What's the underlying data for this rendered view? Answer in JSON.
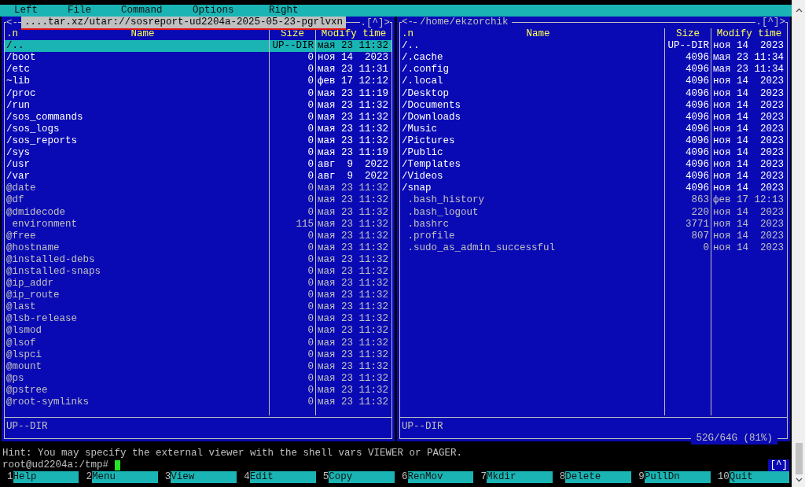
{
  "menu": [
    {
      "label": "Left"
    },
    {
      "label": "File"
    },
    {
      "label": "Command"
    },
    {
      "label": "Options"
    },
    {
      "label": "Right"
    }
  ],
  "panels": [
    {
      "corner_left": "<-",
      "title": "....tar.xz/utar://sosreport-ud2204a-2025-05-23-pgrlvxn",
      "corner_right": ".[^]>",
      "active": true,
      "columns": [
        ".n",
        "Name",
        "Size",
        "Modify time"
      ],
      "status": "UP--DIR",
      "rows": [
        {
          "name": "/..",
          "kind": "dir",
          "size": "UP--DIR",
          "time": "мая 23 11:32",
          "selected": true
        },
        {
          "name": "/boot",
          "kind": "dir",
          "size": "0",
          "time": "ноя 14  2023",
          "selected": false
        },
        {
          "name": "/etc",
          "kind": "dir",
          "size": "0",
          "time": "мая 23 11:31",
          "selected": false
        },
        {
          "name": "~lib",
          "kind": "dir",
          "size": "0",
          "time": "фев 17 12:12",
          "selected": false
        },
        {
          "name": "/proc",
          "kind": "dir",
          "size": "0",
          "time": "мая 23 11:19",
          "selected": false
        },
        {
          "name": "/run",
          "kind": "dir",
          "size": "0",
          "time": "мая 23 11:32",
          "selected": false
        },
        {
          "name": "/sos_commands",
          "kind": "dir",
          "size": "0",
          "time": "мая 23 11:32",
          "selected": false
        },
        {
          "name": "/sos_logs",
          "kind": "dir",
          "size": "0",
          "time": "мая 23 11:32",
          "selected": false
        },
        {
          "name": "/sos_reports",
          "kind": "dir",
          "size": "0",
          "time": "мая 23 11:32",
          "selected": false
        },
        {
          "name": "/sys",
          "kind": "dir",
          "size": "0",
          "time": "мая 23 11:19",
          "selected": false
        },
        {
          "name": "/usr",
          "kind": "dir",
          "size": "0",
          "time": "авг  9  2022",
          "selected": false
        },
        {
          "name": "/var",
          "kind": "dir",
          "size": "0",
          "time": "авг  9  2022",
          "selected": false
        },
        {
          "name": "@date",
          "kind": "link",
          "size": "0",
          "time": "мая 23 11:32",
          "selected": false
        },
        {
          "name": "@df",
          "kind": "link",
          "size": "0",
          "time": "мая 23 11:32",
          "selected": false
        },
        {
          "name": "@dmidecode",
          "kind": "link",
          "size": "0",
          "time": "мая 23 11:32",
          "selected": false
        },
        {
          "name": "environment",
          "kind": "file",
          "size": "115",
          "time": "мая 23 11:32",
          "selected": false
        },
        {
          "name": "@free",
          "kind": "link",
          "size": "0",
          "time": "мая 23 11:32",
          "selected": false
        },
        {
          "name": "@hostname",
          "kind": "link",
          "size": "0",
          "time": "мая 23 11:32",
          "selected": false
        },
        {
          "name": "@installed-debs",
          "kind": "link",
          "size": "0",
          "time": "мая 23 11:32",
          "selected": false
        },
        {
          "name": "@installed-snaps",
          "kind": "link",
          "size": "0",
          "time": "мая 23 11:32",
          "selected": false
        },
        {
          "name": "@ip_addr",
          "kind": "link",
          "size": "0",
          "time": "мая 23 11:32",
          "selected": false
        },
        {
          "name": "@ip_route",
          "kind": "link",
          "size": "0",
          "time": "мая 23 11:32",
          "selected": false
        },
        {
          "name": "@last",
          "kind": "link",
          "size": "0",
          "time": "мая 23 11:32",
          "selected": false
        },
        {
          "name": "@lsb-release",
          "kind": "link",
          "size": "0",
          "time": "мая 23 11:32",
          "selected": false
        },
        {
          "name": "@lsmod",
          "kind": "link",
          "size": "0",
          "time": "мая 23 11:32",
          "selected": false
        },
        {
          "name": "@lsof",
          "kind": "link",
          "size": "0",
          "time": "мая 23 11:32",
          "selected": false
        },
        {
          "name": "@lspci",
          "kind": "link",
          "size": "0",
          "time": "мая 23 11:32",
          "selected": false
        },
        {
          "name": "@mount",
          "kind": "link",
          "size": "0",
          "time": "мая 23 11:32",
          "selected": false
        },
        {
          "name": "@ps",
          "kind": "link",
          "size": "0",
          "time": "мая 23 11:32",
          "selected": false
        },
        {
          "name": "@pstree",
          "kind": "link",
          "size": "0",
          "time": "мая 23 11:32",
          "selected": false
        },
        {
          "name": "@root-symlinks",
          "kind": "link",
          "size": "0",
          "time": "мая 23 11:32",
          "selected": false
        }
      ]
    },
    {
      "corner_left": "<-",
      "title": "/home/ekzorchik",
      "corner_right": ".[^]>",
      "active": false,
      "columns": [
        ".n",
        "Name",
        "Size",
        "Modify time"
      ],
      "status": "UP--DIR",
      "disk": "52G/64G (81%)",
      "rows": [
        {
          "name": "/..",
          "kind": "dir",
          "size": "UP--DIR",
          "time": "ноя 14  2023",
          "selected": false
        },
        {
          "name": "/.cache",
          "kind": "dir",
          "size": "4096",
          "time": "мая 23 11:34",
          "selected": false
        },
        {
          "name": "/.config",
          "kind": "dir",
          "size": "4096",
          "time": "мая 23 11:34",
          "selected": false
        },
        {
          "name": "/.local",
          "kind": "dir",
          "size": "4096",
          "time": "ноя 14  2023",
          "selected": false
        },
        {
          "name": "/Desktop",
          "kind": "dir",
          "size": "4096",
          "time": "ноя 14  2023",
          "selected": false
        },
        {
          "name": "/Documents",
          "kind": "dir",
          "size": "4096",
          "time": "ноя 14  2023",
          "selected": false
        },
        {
          "name": "/Downloads",
          "kind": "dir",
          "size": "4096",
          "time": "ноя 14  2023",
          "selected": false
        },
        {
          "name": "/Music",
          "kind": "dir",
          "size": "4096",
          "time": "ноя 14  2023",
          "selected": false
        },
        {
          "name": "/Pictures",
          "kind": "dir",
          "size": "4096",
          "time": "ноя 14  2023",
          "selected": false
        },
        {
          "name": "/Public",
          "kind": "dir",
          "size": "4096",
          "time": "ноя 14  2023",
          "selected": false
        },
        {
          "name": "/Templates",
          "kind": "dir",
          "size": "4096",
          "time": "ноя 14  2023",
          "selected": false
        },
        {
          "name": "/Videos",
          "kind": "dir",
          "size": "4096",
          "time": "ноя 14  2023",
          "selected": false
        },
        {
          "name": "/snap",
          "kind": "dir",
          "size": "4096",
          "time": "ноя 14  2023",
          "selected": false
        },
        {
          "name": ".bash_history",
          "kind": "file",
          "size": "863",
          "time": "фев 17 12:13",
          "selected": false
        },
        {
          "name": ".bash_logout",
          "kind": "file",
          "size": "220",
          "time": "ноя 14  2023",
          "selected": false
        },
        {
          "name": ".bashrc",
          "kind": "file",
          "size": "3771",
          "time": "ноя 14  2023",
          "selected": false
        },
        {
          "name": ".profile",
          "kind": "file",
          "size": "807",
          "time": "ноя 14  2023",
          "selected": false
        },
        {
          "name": ".sudo_as_admin_successful",
          "kind": "file",
          "size": "0",
          "time": "ноя 14  2023",
          "selected": false
        }
      ]
    }
  ],
  "hint": "Hint: You may specify the external viewer with the shell vars VIEWER or PAGER.",
  "prompt": "root@ud2204a:/tmp#",
  "prompt_badge": "[^]",
  "fkeys": [
    {
      "num": "1",
      "label": "Help"
    },
    {
      "num": "2",
      "label": "Menu"
    },
    {
      "num": "3",
      "label": "View"
    },
    {
      "num": "4",
      "label": "Edit"
    },
    {
      "num": "5",
      "label": "Copy"
    },
    {
      "num": "6",
      "label": "RenMov"
    },
    {
      "num": "7",
      "label": "Mkdir"
    },
    {
      "num": "8",
      "label": "Delete"
    },
    {
      "num": "9",
      "label": "PullDn"
    },
    {
      "num": "10",
      "label": "Quit"
    }
  ]
}
